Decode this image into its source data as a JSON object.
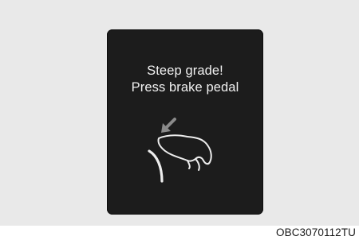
{
  "display": {
    "message_line1": "Steep grade!",
    "message_line2": "Press brake pedal"
  },
  "icons": {
    "pedal": "foot-on-brake-pedal-icon"
  },
  "caption": "OBC3070112TU",
  "colors": {
    "background": "#e9e9e9",
    "display": "#1c1c1c",
    "text": "#f1f1f1",
    "icon_arrow": "#8a8a8a"
  }
}
